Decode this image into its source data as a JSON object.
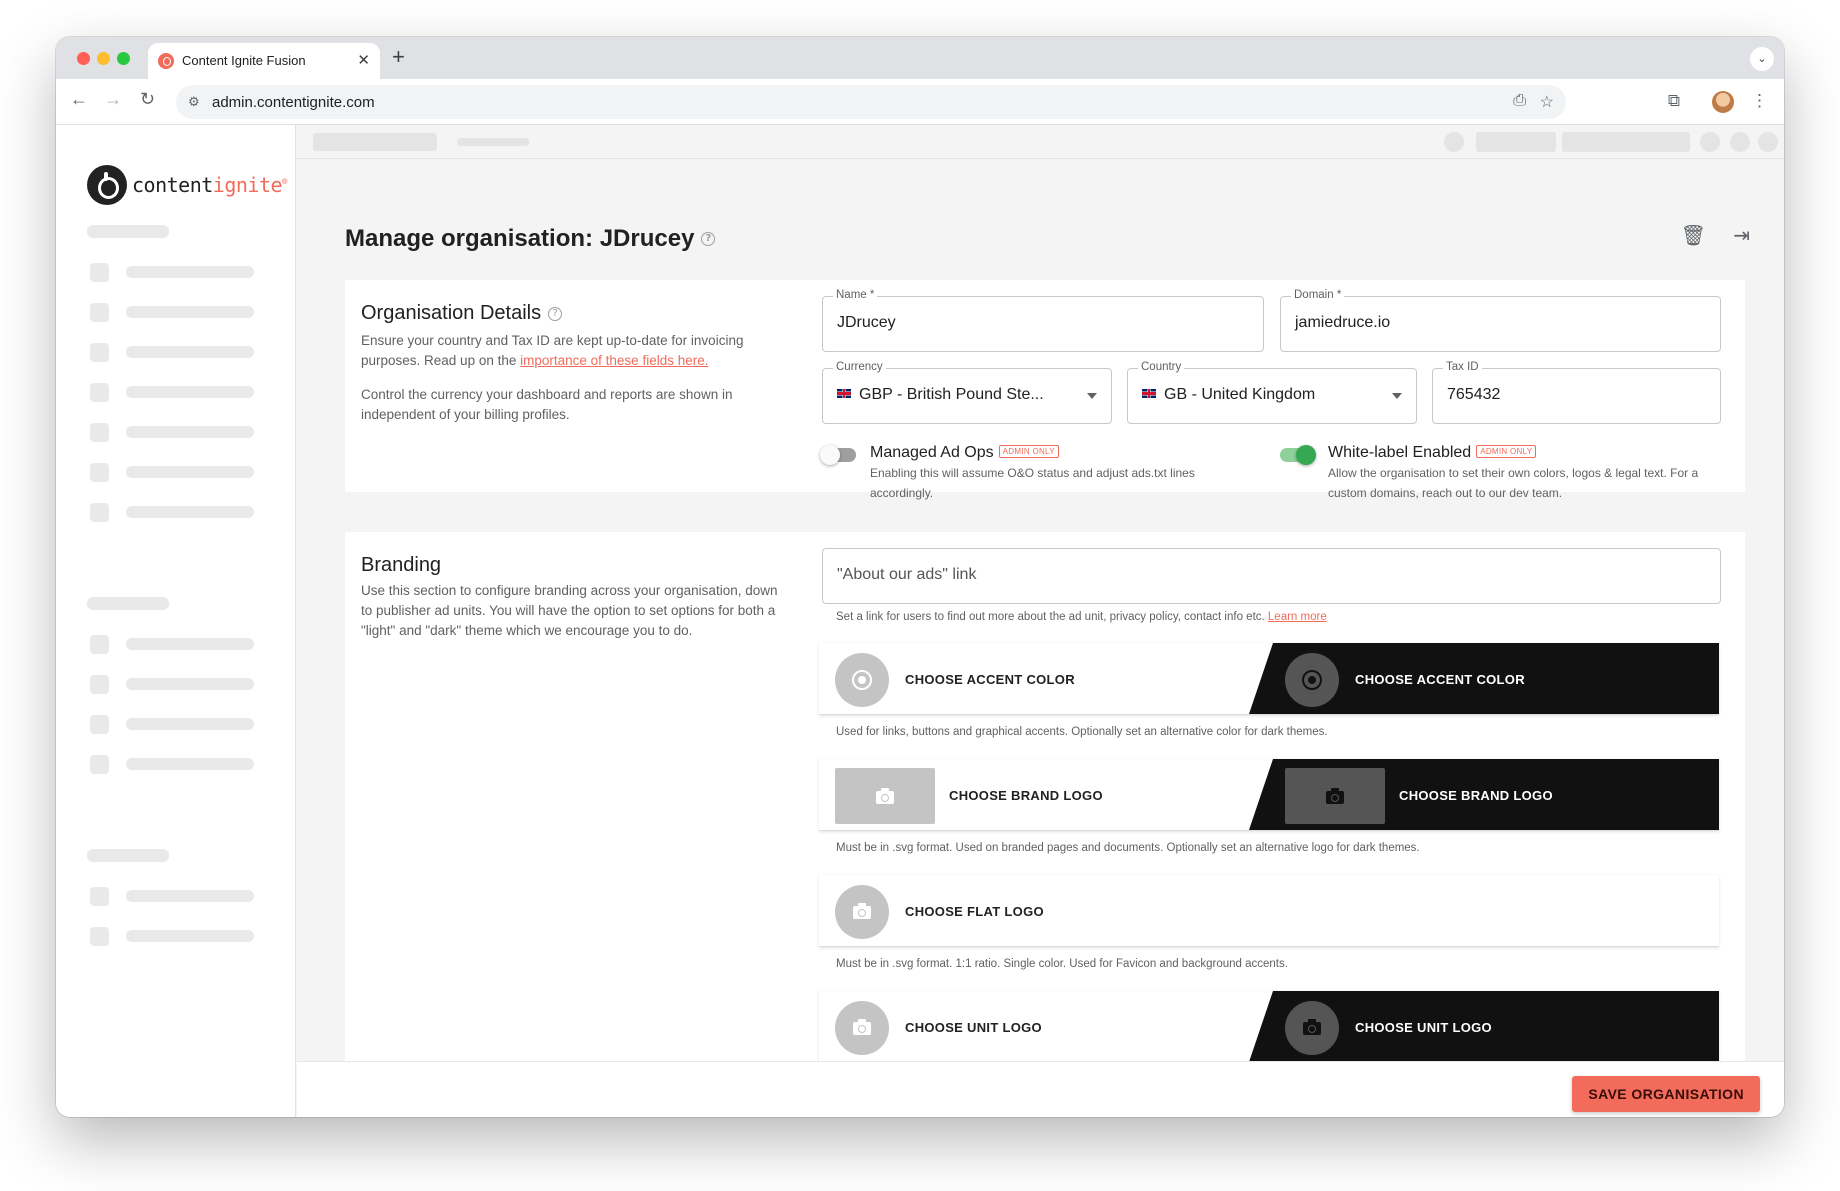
{
  "browser": {
    "tab_title": "Content Ignite Fusion",
    "tab_close": "✕",
    "new_tab": "+",
    "url": "admin.contentignite.com"
  },
  "logo": {
    "part1": "content",
    "part2": "ignite",
    "mark": "®"
  },
  "page": {
    "title": "Manage organisation: JDrucey"
  },
  "org_details": {
    "title": "Organisation Details",
    "desc_line1": "Ensure your country and Tax ID are kept up-to-date for invoicing purposes. Read up on the ",
    "desc_link": "importance of these fields here.",
    "desc_line2": "Control the currency your dashboard and reports are shown in independent of your billing profiles.",
    "name": {
      "label": "Name *",
      "value": "JDrucey"
    },
    "domain": {
      "label": "Domain *",
      "value": "jamiedruce.io"
    },
    "currency": {
      "label": "Currency",
      "value": "GBP - British Pound Ste..."
    },
    "country": {
      "label": "Country",
      "value": "GB - United Kingdom"
    },
    "tax_id": {
      "label": "Tax ID",
      "value": "765432"
    },
    "managed_ad_ops": {
      "label": "Managed Ad Ops",
      "badge": "ADMIN ONLY",
      "help": "Enabling this will assume O&O status and adjust ads.txt lines accordingly.",
      "enabled": false
    },
    "white_label": {
      "label": "White-label Enabled",
      "badge": "ADMIN ONLY",
      "help": "Allow the organisation to set their own colors, logos & legal text. For a custom domains, reach out to our dev team.",
      "enabled": true
    }
  },
  "branding": {
    "title": "Branding",
    "desc": "Use this section to configure branding across your organisation, down to publisher ad units. You will have the option to set options for both a \"light\" and \"dark\" theme which we encourage you to do.",
    "about_ads": {
      "placeholder": "\"About our ads\" link",
      "hint": "Set a link for users to find out more about the ad unit, privacy policy, contact info etc. ",
      "hint_link": "Learn more"
    },
    "accent": {
      "light_label": "CHOOSE ACCENT COLOR",
      "dark_label": "CHOOSE ACCENT COLOR",
      "hint": "Used for links, buttons and graphical accents. Optionally set an alternative color for dark themes."
    },
    "brand_logo": {
      "light_label": "CHOOSE BRAND LOGO",
      "dark_label": "CHOOSE BRAND LOGO",
      "hint": "Must be in .svg format. Used on branded pages and documents. Optionally set an alternative logo for dark themes."
    },
    "flat_logo": {
      "label": "CHOOSE FLAT LOGO",
      "hint": "Must be in .svg format. 1:1 ratio. Single color. Used for Favicon and background accents."
    },
    "unit_logo": {
      "light_label": "CHOOSE UNIT LOGO",
      "dark_label": "CHOOSE UNIT LOGO"
    }
  },
  "footer": {
    "save_label": "SAVE ORGANISATION"
  },
  "colors": {
    "accent": "#f26b5b",
    "toggle_on": "#34a853",
    "dark_panel": "#111111"
  }
}
